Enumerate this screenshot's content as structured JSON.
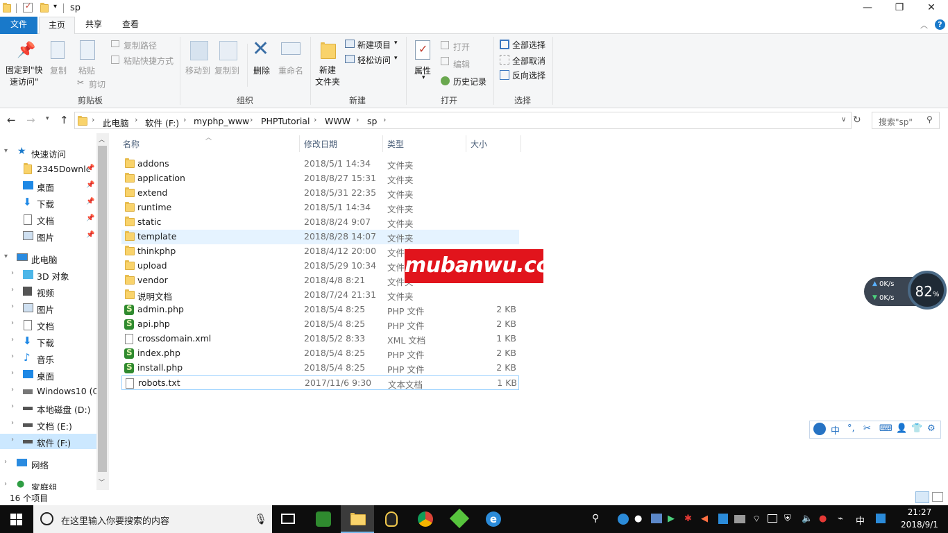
{
  "window": {
    "title": "sp",
    "controls": {
      "minimize": "—",
      "maximize": "❐",
      "close": "✕"
    }
  },
  "tabs": [
    "文件",
    "主页",
    "共享",
    "查看"
  ],
  "ribbon": {
    "pin": "固定到\"快\n速访问\"",
    "copy": "复制",
    "paste": "粘贴",
    "copy_path": "复制路径",
    "paste_shortcut": "粘贴快捷方式",
    "cut": "剪切",
    "clipboard_group": "剪贴板",
    "move_to": "移动到",
    "copy_to": "复制到",
    "delete": "删除",
    "rename": "重命名",
    "organize_group": "组织",
    "new_folder": "新建\n文件夹",
    "new_item": "新建项目",
    "easy_access": "轻松访问",
    "new_group": "新建",
    "properties": "属性",
    "open": "打开",
    "edit": "编辑",
    "history": "历史记录",
    "open_group": "打开",
    "select_all": "全部选择",
    "select_none": "全部取消",
    "invert_selection": "反向选择",
    "select_group": "选择"
  },
  "address": {
    "crumbs": [
      "此电脑",
      "软件 (F:)",
      "myphp_www",
      "PHPTutorial",
      "WWW",
      "sp"
    ],
    "search_placeholder": "搜索\"sp\""
  },
  "nav": {
    "quick_access": "快速访问",
    "quick_items": [
      "2345Downlc",
      "桌面",
      "下载",
      "文档",
      "图片"
    ],
    "this_pc": "此电脑",
    "pc_items": [
      "3D 对象",
      "视频",
      "图片",
      "文档",
      "下载",
      "音乐",
      "桌面",
      "Windows10 (C:",
      "本地磁盘 (D:)",
      "文档 (E:)",
      "软件 (F:)"
    ],
    "network": "网络",
    "homegroup": "家庭组"
  },
  "columns": {
    "name": "名称",
    "date": "修改日期",
    "type": "类型",
    "size": "大小"
  },
  "files": [
    {
      "name": "addons",
      "date": "2018/5/1 14:34",
      "type": "文件夹",
      "size": "",
      "kind": "folder"
    },
    {
      "name": "application",
      "date": "2018/8/27 15:31",
      "type": "文件夹",
      "size": "",
      "kind": "folder"
    },
    {
      "name": "extend",
      "date": "2018/5/31 22:35",
      "type": "文件夹",
      "size": "",
      "kind": "folder"
    },
    {
      "name": "runtime",
      "date": "2018/5/1 14:34",
      "type": "文件夹",
      "size": "",
      "kind": "folder"
    },
    {
      "name": "static",
      "date": "2018/8/24 9:07",
      "type": "文件夹",
      "size": "",
      "kind": "folder"
    },
    {
      "name": "template",
      "date": "2018/8/28 14:07",
      "type": "文件夹",
      "size": "",
      "kind": "folder"
    },
    {
      "name": "thinkphp",
      "date": "2018/4/12 20:00",
      "type": "文件夹",
      "size": "",
      "kind": "folder"
    },
    {
      "name": "upload",
      "date": "2018/5/29 10:34",
      "type": "文件夹",
      "size": "",
      "kind": "folder"
    },
    {
      "name": "vendor",
      "date": "2018/4/8 8:21",
      "type": "文件夹",
      "size": "",
      "kind": "folder"
    },
    {
      "name": "说明文档",
      "date": "2018/7/24 21:31",
      "type": "文件夹",
      "size": "",
      "kind": "folder"
    },
    {
      "name": "admin.php",
      "date": "2018/5/4 8:25",
      "type": "PHP 文件",
      "size": "2 KB",
      "kind": "php"
    },
    {
      "name": "api.php",
      "date": "2018/5/4 8:25",
      "type": "PHP 文件",
      "size": "2 KB",
      "kind": "php"
    },
    {
      "name": "crossdomain.xml",
      "date": "2018/5/2 8:33",
      "type": "XML 文档",
      "size": "1 KB",
      "kind": "xml"
    },
    {
      "name": "index.php",
      "date": "2018/5/4 8:25",
      "type": "PHP 文件",
      "size": "2 KB",
      "kind": "php"
    },
    {
      "name": "install.php",
      "date": "2018/5/4 8:25",
      "type": "PHP 文件",
      "size": "2 KB",
      "kind": "php"
    },
    {
      "name": "robots.txt",
      "date": "2017/11/6 9:30",
      "type": "文本文档",
      "size": "1 KB",
      "kind": "txt"
    }
  ],
  "status": {
    "count": "16 个项目"
  },
  "watermark": "mubanwu.cc",
  "speed_widget": {
    "up": "0K/s",
    "down": "0K/s",
    "percent": "82",
    "percent_unit": "%"
  },
  "ime": {
    "mode": "中"
  },
  "taskbar": {
    "search_placeholder": "在这里输入你要搜索的内容",
    "time": "21:27",
    "date": "2018/9/1",
    "ime_indicator": "中"
  },
  "colors": {
    "accent": "#1979ca",
    "selection": "#cce8ff",
    "hover": "#e5f3ff",
    "folder": "#f9d36b",
    "watermark": "#e1141c"
  }
}
